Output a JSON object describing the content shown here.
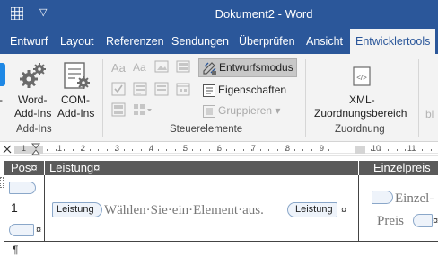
{
  "titlebar": {
    "title": "Dokument2  -  Word",
    "qat_arrow": "▽"
  },
  "tabs": [
    {
      "label": "Entwurf"
    },
    {
      "label": "Layout"
    },
    {
      "label": "Referenzen"
    },
    {
      "label": "Sendungen"
    },
    {
      "label": "Überprüfen"
    },
    {
      "label": "Ansicht"
    },
    {
      "label": "Entwicklertools"
    }
  ],
  "ribbon": {
    "addins": {
      "word_addins_line1": "Word-",
      "word_addins_line2": "Add-Ins",
      "com_addins_line1": "COM-",
      "com_addins_line2": "Add-Ins",
      "group_label": "Add-Ins"
    },
    "controls": {
      "design_mode": "Entwurfsmodus",
      "properties": "Eigenschaften",
      "group": "Gruppieren",
      "group_arrow": "▾",
      "group_label": "Steuerelemente"
    },
    "mapping": {
      "xml_line1": "XML-",
      "xml_line2": "Zuordnungsbereich",
      "group_label": "Zuordnung"
    },
    "cut_off_label": "bl"
  },
  "ruler": {
    "numbers": [
      "1",
      "1",
      "2",
      "3",
      "4",
      "5",
      "6",
      "7",
      "8",
      "9",
      "10",
      "11"
    ]
  },
  "table": {
    "headers": {
      "pos": "Pos¤",
      "leistung": "Leistung¤",
      "einzelpreis": "Einzelpreis"
    },
    "row1": {
      "pos_number": "1",
      "pos_end_mark": "¤",
      "leistung_tag_start": "Leistung",
      "leistung_placeholder": "Wählen·Sie·ein·Element·aus.",
      "leistung_tag_end": "Leistung",
      "leistung_end_mark": "¤",
      "preis_line1": "Einzel-",
      "preis_line2": "Preis",
      "preis_end_mark": "¤"
    },
    "paragraph_mark": "¶"
  },
  "colors": {
    "word_blue": "#2b579a",
    "ribbon_bg": "#f3f3f3",
    "table_header": "#5a5a5a"
  }
}
